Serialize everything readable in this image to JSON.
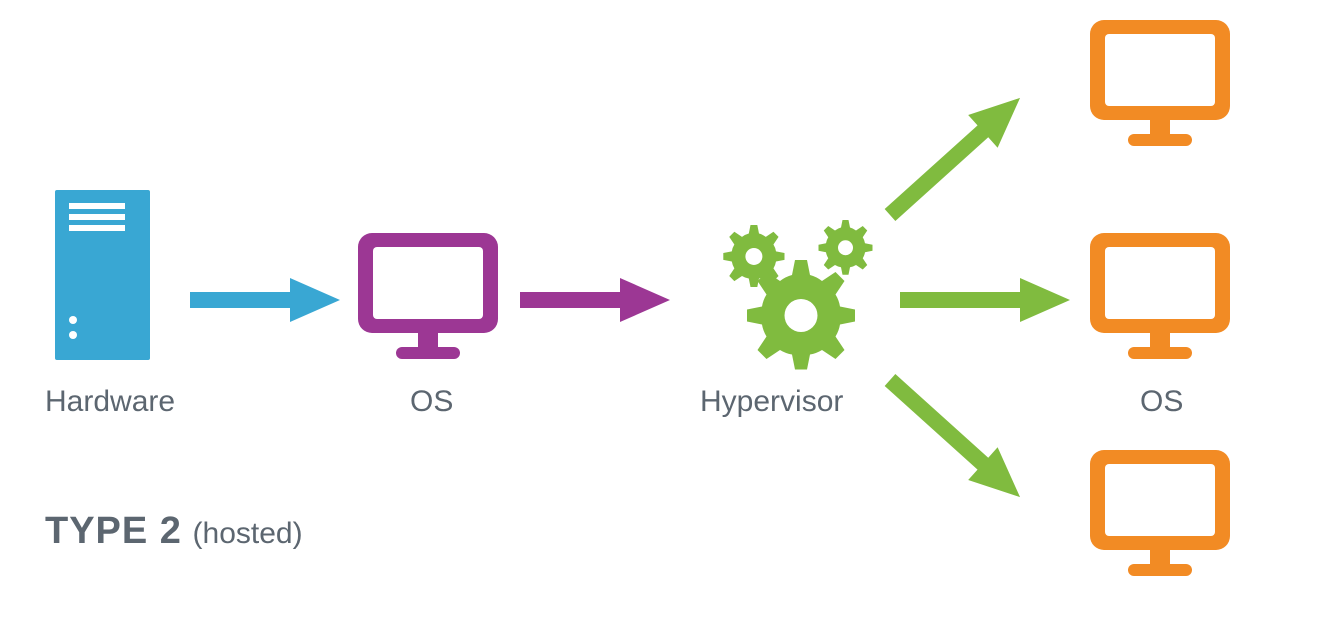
{
  "diagram": {
    "title_strong": "TYPE 2",
    "title_sub": "(hosted)",
    "hardware_label": "Hardware",
    "os_label": "OS",
    "hypervisor_label": "Hypervisor",
    "guest_os_label": "OS"
  },
  "colors": {
    "blue": "#39a7d3",
    "purple": "#9c3794",
    "green": "#80bb3f",
    "orange": "#f28b24",
    "text": "#5c6670"
  },
  "nodes": [
    {
      "id": "hardware",
      "kind": "server",
      "label_key": "hardware_label"
    },
    {
      "id": "host-os",
      "kind": "monitor",
      "label_key": "os_label"
    },
    {
      "id": "hypervisor",
      "kind": "gears",
      "label_key": "hypervisor_label"
    },
    {
      "id": "guest-os",
      "kind": "monitors",
      "label_key": "guest_os_label",
      "count": 3
    }
  ],
  "edges": [
    {
      "from": "hardware",
      "to": "host-os",
      "color_key": "blue"
    },
    {
      "from": "host-os",
      "to": "hypervisor",
      "color_key": "purple"
    },
    {
      "from": "hypervisor",
      "to": "guest-os",
      "color_key": "green",
      "fanout": 3
    }
  ]
}
